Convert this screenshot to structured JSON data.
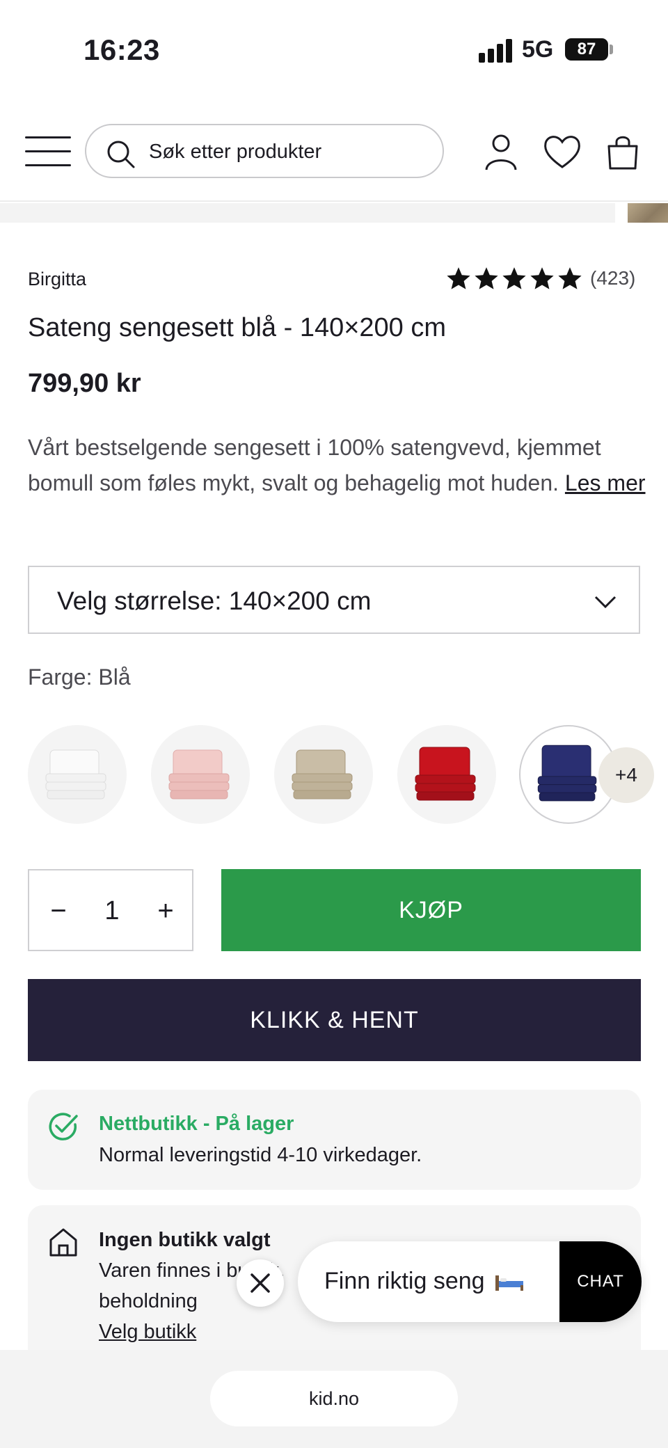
{
  "status_bar": {
    "time": "16:23",
    "network": "5G",
    "battery": "87"
  },
  "header": {
    "search_placeholder": "Søk etter produkter"
  },
  "product": {
    "brand": "Birgitta",
    "rating_count": "(423)",
    "rating_stars": 5,
    "title": "Sateng sengesett blå - 140×200 cm",
    "price": "799,90 kr",
    "description": "Vårt bestselgende sengesett i 100% satengvevd, kjemmet bomull som føles mykt, svalt og behagelig mot huden.",
    "read_more": "Les mer"
  },
  "size_select": {
    "label": "Velg størrelse: 140×200 cm"
  },
  "color": {
    "label": "Farge:",
    "value": "Blå",
    "more": "+4",
    "swatches": [
      {
        "name": "white",
        "color": "#eeeeee"
      },
      {
        "name": "pink",
        "color": "#e9b9b7"
      },
      {
        "name": "beige",
        "color": "#b9ab92"
      },
      {
        "name": "red",
        "color": "#b4141d"
      },
      {
        "name": "blue",
        "color": "#252a66"
      }
    ]
  },
  "quantity": {
    "minus": "−",
    "value": "1",
    "plus": "+"
  },
  "buttons": {
    "buy": "KJØP",
    "click_collect": "KLIKK & HENT"
  },
  "stock": {
    "online_title": "Nettbutikk - På lager",
    "online_text": "Normal leveringstid 4-10 virkedager."
  },
  "store": {
    "title": "Ingen butikk valgt",
    "line2": "Varen finnes i butikk,",
    "line3": "beholdning",
    "link": "Velg butikk"
  },
  "chat": {
    "prompt": "Finn riktig seng",
    "button": "CHAT"
  },
  "browser": {
    "url": "kid.no"
  },
  "colors": {
    "buy_green": "#2b9a4a",
    "dark_navy": "#25213a",
    "stock_green": "#2aab63"
  }
}
